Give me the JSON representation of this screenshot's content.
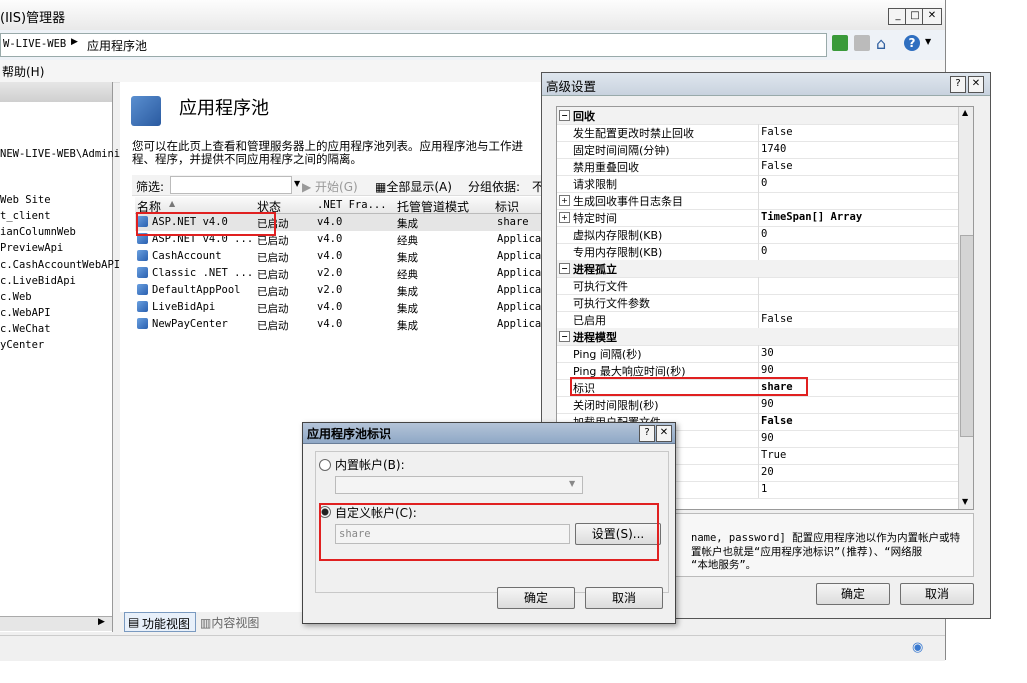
{
  "window": {
    "title": "(IIS)管理器",
    "breadcrumb": [
      "W-LIVE-WEB",
      "应用程序池"
    ],
    "menu": [
      "帮助(H)"
    ]
  },
  "tree": {
    "items": [
      "NEW-LIVE-WEB\\Admini",
      "Web Site",
      "t_client",
      "ianColumnWeb",
      "PreviewApi",
      "c.CashAccountWebAPI",
      "c.LiveBidApi",
      "c.Web",
      "c.WebAPI",
      "c.WeChat",
      "yCenter"
    ]
  },
  "pools": {
    "title": "应用程序池",
    "description": "您可以在此页上查看和管理服务器上的应用程序池列表。应用程序池与工作进程、程序，并提供不同应用程序之间的隔离。",
    "filter_label": "筛选:",
    "start_label": "开始(G)",
    "showall_label": "全部显示(A)",
    "groupby_label": "分组依据:",
    "groupby_value": "不",
    "columns": [
      "名称",
      "状态",
      ".NET Fra...",
      "托管管道模式",
      "标识"
    ],
    "rows": [
      {
        "name": "ASP.NET v4.0",
        "status": "已启动",
        "net": "v4.0",
        "mode": "集成",
        "identity": "share"
      },
      {
        "name": "ASP.NET v4.0 ...",
        "status": "已启动",
        "net": "v4.0",
        "mode": "经典",
        "identity": "Applica"
      },
      {
        "name": "CashAccount",
        "status": "已启动",
        "net": "v4.0",
        "mode": "集成",
        "identity": "Applica"
      },
      {
        "name": "Classic .NET ...",
        "status": "已启动",
        "net": "v2.0",
        "mode": "经典",
        "identity": "Applica"
      },
      {
        "name": "DefaultAppPool",
        "status": "已启动",
        "net": "v2.0",
        "mode": "集成",
        "identity": "Applica"
      },
      {
        "name": "LiveBidApi",
        "status": "已启动",
        "net": "v4.0",
        "mode": "集成",
        "identity": "Applica"
      },
      {
        "name": "NewPayCenter",
        "status": "已启动",
        "net": "v4.0",
        "mode": "集成",
        "identity": "Applica"
      }
    ],
    "view_tabs": [
      "功能视图",
      "内容视图"
    ]
  },
  "advanced": {
    "title": "高级设置",
    "rows": [
      {
        "kind": "cat",
        "name": "回收",
        "value": ""
      },
      {
        "kind": "prop",
        "name": "发生配置更改时禁止回收",
        "value": "False"
      },
      {
        "kind": "prop",
        "name": "固定时间间隔(分钟)",
        "value": "1740"
      },
      {
        "kind": "prop",
        "name": "禁用重叠回收",
        "value": "False"
      },
      {
        "kind": "prop",
        "name": "请求限制",
        "value": "0"
      },
      {
        "kind": "sub",
        "name": "生成回收事件日志条目",
        "value": ""
      },
      {
        "kind": "sub",
        "name": "特定时间",
        "value": "TimeSpan[] Array"
      },
      {
        "kind": "prop",
        "name": "虚拟内存限制(KB)",
        "value": "0"
      },
      {
        "kind": "prop",
        "name": "专用内存限制(KB)",
        "value": "0"
      },
      {
        "kind": "cat",
        "name": "进程孤立",
        "value": ""
      },
      {
        "kind": "prop",
        "name": "可执行文件",
        "value": ""
      },
      {
        "kind": "prop",
        "name": "可执行文件参数",
        "value": ""
      },
      {
        "kind": "prop",
        "name": "已启用",
        "value": "False"
      },
      {
        "kind": "cat",
        "name": "进程模型",
        "value": ""
      },
      {
        "kind": "prop",
        "name": "Ping 间隔(秒)",
        "value": "30"
      },
      {
        "kind": "prop",
        "name": "Ping 最大响应时间(秒)",
        "value": "90"
      },
      {
        "kind": "prop",
        "name": "标识",
        "value": "share"
      },
      {
        "kind": "prop",
        "name": "关闭时间限制(秒)",
        "value": "90"
      },
      {
        "kind": "prop",
        "name": "加载用户配置文件",
        "value": "False"
      },
      {
        "kind": "prop",
        "name": "",
        "value": "90"
      },
      {
        "kind": "prop",
        "name": "",
        "value": "True"
      },
      {
        "kind": "prop",
        "name": "",
        "value": "20"
      },
      {
        "kind": "prop",
        "name": "",
        "value": "1"
      }
    ],
    "desc_line1": "name, password] 配置应用程序池以作为内置帐户或特",
    "desc_line2": "置帐户也就是“应用程序池标识”(推荐)、“网络服",
    "desc_line3": "“本地服务”。",
    "ok_label": "确定",
    "cancel_label": "取消"
  },
  "identity_dialog": {
    "title": "应用程序池标识",
    "builtin_label": "内置帐户(B):",
    "custom_label": "自定义帐户(C):",
    "custom_value": "share",
    "set_label": "设置(S)...",
    "ok_label": "确定",
    "cancel_label": "取消"
  },
  "colors": {
    "highlight": "#e02020",
    "dialog_title": "#8fa8c6",
    "panel_bg": "#f0f0f0"
  }
}
